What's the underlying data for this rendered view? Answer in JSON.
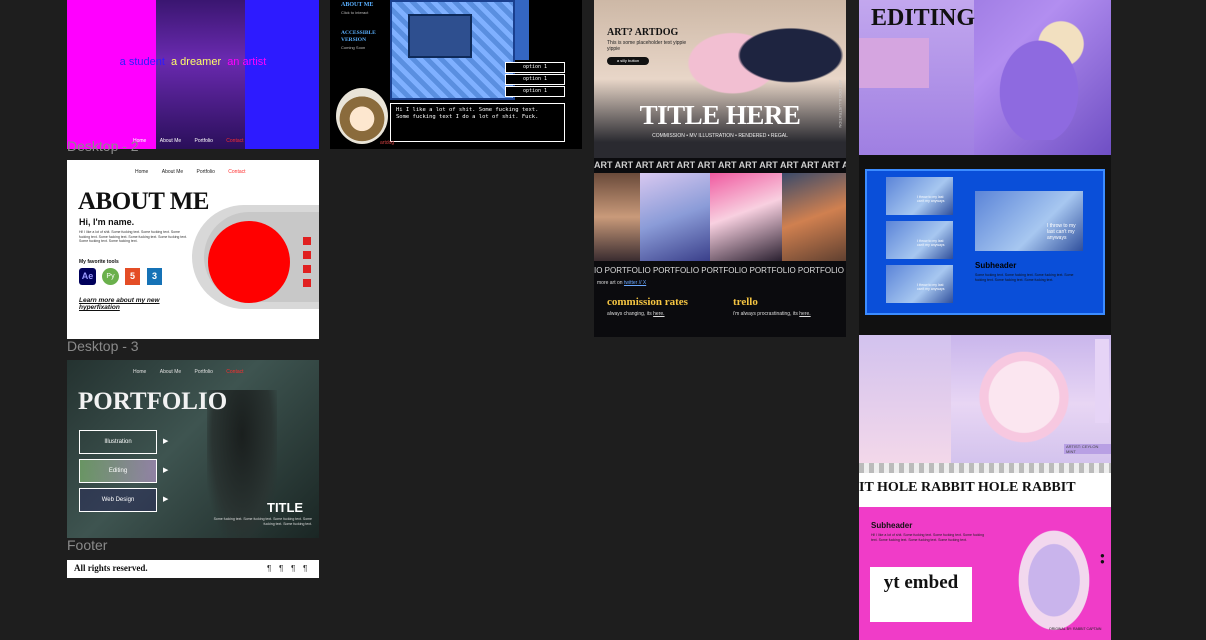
{
  "labels": {
    "desktop2": "Desktop - 2",
    "desktop3": "Desktop - 3",
    "footer": "Footer"
  },
  "hero": {
    "student": "a student",
    "dreamer": "a dreamer",
    "artist": "an artist"
  },
  "nav": {
    "home": "Home",
    "about": "About Me",
    "portfolio": "Portfolio",
    "contact": "Contact"
  },
  "about": {
    "title": "ABOUT ME",
    "greeting": "Hi, I'm name.",
    "body": "Hi! I like a lot of shit. Some fucking text. Some fucking text. Some fucking text. Some fucking text. Some fucking text. Some fucking text. Some fucking text. Some fucking text.",
    "tools_heading": "My favorite tools",
    "tools": [
      "Ae",
      "Py",
      "5",
      "3"
    ],
    "link": "Learn more about my new hyperfixation"
  },
  "portfolio": {
    "title": "PORTFOLIO",
    "items": [
      "Illustration",
      "Editing",
      "Web Design"
    ],
    "card_title": "TITLE",
    "card_text": "Some fucking text. Some fucking text. Some fucking text. Some fucking text. Some fucking text."
  },
  "footer": {
    "text": "All rights reserved."
  },
  "game": {
    "about": "ABOUT ME",
    "about_sub": "Click to interact",
    "accessible": "ACCESSIBLE VERSION",
    "coming": "Coming Soon",
    "options": [
      "option 1",
      "option 1",
      "option 1"
    ],
    "dialog": "Hi I like a lot of shit. Some fucking text. Some fucking text I do a lot of shit. Fuck.",
    "speaker": "artdog"
  },
  "artdog": {
    "site_title": "ART? ARTDOG",
    "placeholder": "This is some placeholder text yippie yippie",
    "button": "a silly button",
    "title": "TITLE HERE",
    "subtitle": "COMMISSION • MV ILLUSTRATION • RENDERED • REGAL",
    "vertical": "ART DOG ILLUSTRATION",
    "marquee_art": "ART ART ART ART ART ART ART ART ART ART ART ART ART ART",
    "marquee_portfolio": "IO PORTFOLIO PORTFOLIO PORTFOLIO PORTFOLIO PORTFOLIO",
    "more_art": "more art on",
    "more_art_link": "twitter // X",
    "commission_title": "commission rates",
    "commission_text": "always changing, its",
    "commission_link": "here.",
    "trello_title": "trello",
    "trello_text": "i'm always procrastinating, its",
    "trello_link": "here."
  },
  "editing": {
    "title": "EDITING"
  },
  "blue": {
    "thumb_text": "I throw to my last can't my anyways",
    "subheader": "Subheader",
    "body": "Some fucking text. Some fucking text. Some fucking text. Some fucking text. Some fucking text. Some fucking text."
  },
  "rabbit": {
    "caption": "ARTIST: CEYLON MINT",
    "marquee": "IT HOLE RABBIT HOLE RABBIT",
    "subheader": "Subheader",
    "body": "Hi! I like a lot of shit. Some fucking text. Some fucking text. Some fucking text. Some fucking text. Some fucking text. Some fucking text.",
    "embed": "yt embed",
    "credit": "ORIGINAL BY: RABBIT CAPTAIN"
  },
  "colors": {
    "canvas": "#1e1e1e",
    "magenta": "#ff00ff",
    "purple": "#4a1a9c",
    "blue": "#2d1bff",
    "red": "#ff0000",
    "royal": "#0a4fd9",
    "hotpink": "#f03cc8"
  }
}
